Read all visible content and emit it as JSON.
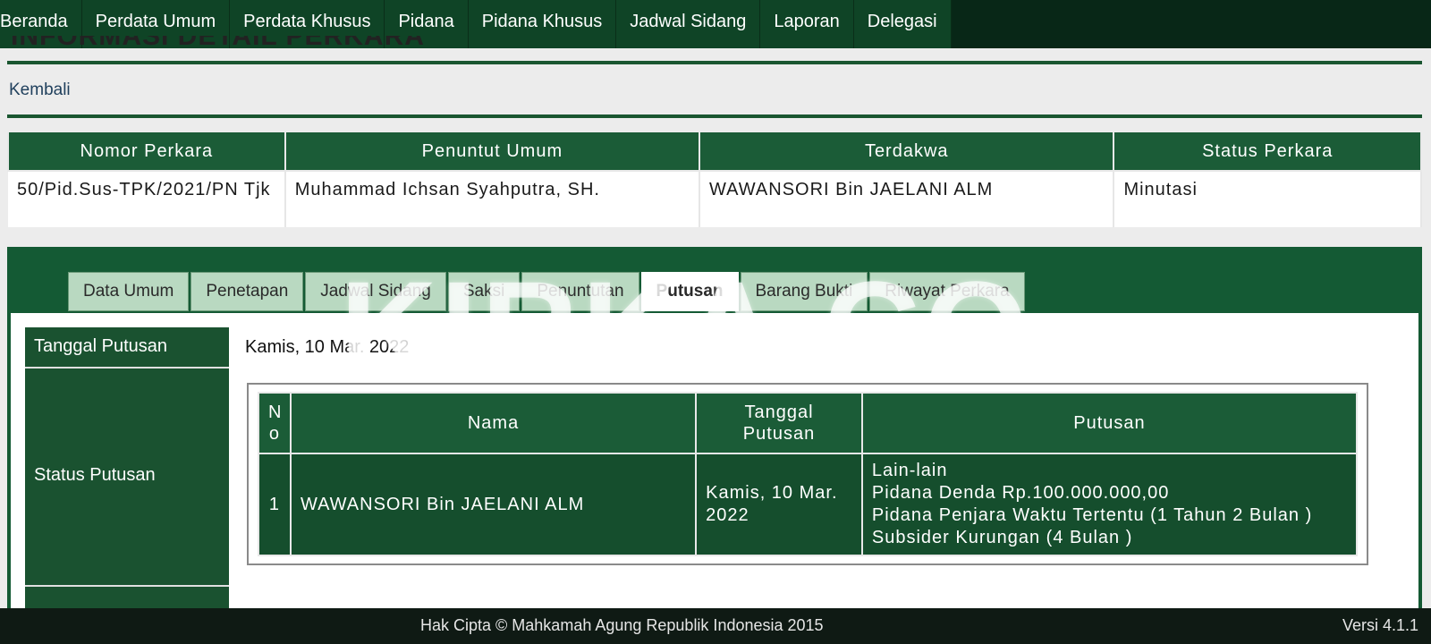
{
  "nav": {
    "items": [
      "Beranda",
      "Perdata Umum",
      "Perdata Khusus",
      "Pidana",
      "Pidana Khusus",
      "Jadwal Sidang",
      "Laporan",
      "Delegasi"
    ]
  },
  "heading": "INFORMASI DETAIL PERKARA",
  "back_link": "Kembali",
  "summary": {
    "headers": [
      "Nomor Perkara",
      "Penuntut Umum",
      "Terdakwa",
      "Status Perkara"
    ],
    "row": [
      "50/Pid.Sus-TPK/2021/PN Tjk",
      "Muhammad Ichsan Syahputra, SH.",
      "WAWANSORI Bin JAELANI ALM",
      "Minutasi"
    ]
  },
  "tabs": {
    "items": [
      "Data Umum",
      "Penetapan",
      "Jadwal Sidang",
      "Saksi",
      "Penuntutan",
      "Putusan",
      "Barang Bukti",
      "Riwayat Perkara"
    ],
    "active": "Putusan"
  },
  "putusan": {
    "tanggal_label": "Tanggal Putusan",
    "tanggal_value": "Kamis, 10 Mar. 2022",
    "status_label": "Status Putusan",
    "table": {
      "headers": {
        "no": "No",
        "nama": "Nama",
        "tanggal": "Tanggal Putusan",
        "putusan": "Putusan"
      },
      "rows": [
        {
          "no": "1",
          "nama": "WAWANSORI Bin JAELANI ALM",
          "tanggal": "Kamis, 10 Mar. 2022",
          "putusan": [
            "Lain-lain",
            "Pidana Denda Rp.100.000.000,00",
            "Pidana Penjara Waktu Tertentu (1 Tahun 2 Bulan )",
            "Subsider Kurungan (4 Bulan )"
          ]
        }
      ]
    }
  },
  "footer": {
    "copyright": "Hak Cipta © Mahkamah Agung Republik Indonesia 2015",
    "version": "Versi 4.1.1"
  },
  "watermark": "KIRKA.CO",
  "colors": {
    "primary_green": "#1b5c37",
    "nav_bg": "#0d3d22",
    "tab_bg": "#b9d9c1",
    "footer_bg": "#0f1a14"
  }
}
